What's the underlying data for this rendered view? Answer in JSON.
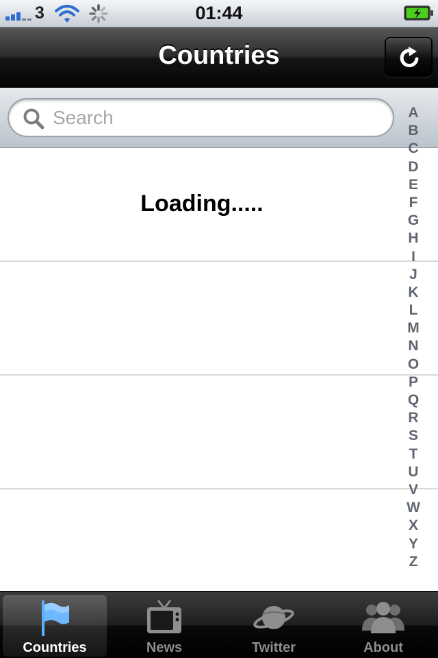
{
  "status_bar": {
    "carrier": "3",
    "time": "01:44"
  },
  "nav": {
    "title": "Countries",
    "refresh_icon": "refresh-icon"
  },
  "search": {
    "placeholder": "Search",
    "value": ""
  },
  "table": {
    "loading_text": "Loading....."
  },
  "index_letters": [
    "A",
    "B",
    "C",
    "D",
    "E",
    "F",
    "G",
    "H",
    "I",
    "J",
    "K",
    "L",
    "M",
    "N",
    "O",
    "P",
    "Q",
    "R",
    "S",
    "T",
    "U",
    "V",
    "W",
    "X",
    "Y",
    "Z"
  ],
  "tabs": [
    {
      "label": "Countries",
      "icon": "flag-icon",
      "selected": true
    },
    {
      "label": "News",
      "icon": "tv-icon",
      "selected": false
    },
    {
      "label": "Twitter",
      "icon": "planet-icon",
      "selected": false
    },
    {
      "label": "About",
      "icon": "people-icon",
      "selected": false
    }
  ],
  "colors": {
    "accent_blue": "#2f6fcf",
    "battery_green": "#4cd01c",
    "index_gray": "#5f6670"
  }
}
